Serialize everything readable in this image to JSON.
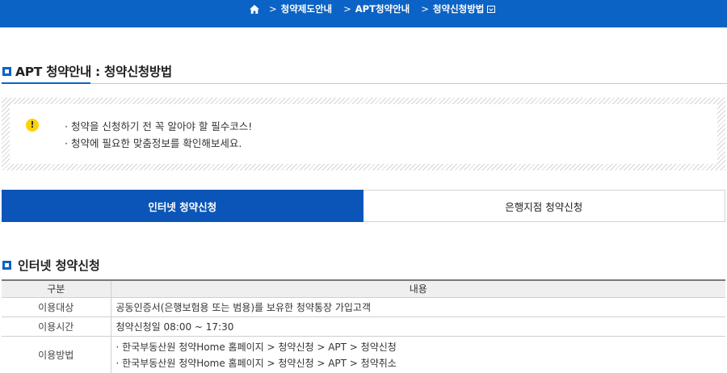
{
  "breadcrumb": {
    "home_icon": "home-icon",
    "separator": ">",
    "items": [
      "청약제도안내",
      "APT청약안내",
      "청약신청방법"
    ],
    "dropdown_icon": "chevron-down-box-icon"
  },
  "page": {
    "title": "APT 청약안내 : 청약신청방법"
  },
  "notice": {
    "icon": "exclamation-icon",
    "icon_glyph": "!",
    "lines": [
      "· 청약을 신청하기 전 꼭 알아야 할 필수코스!",
      "· 청약에 필요한 맞춤정보를 확인해보세요."
    ]
  },
  "tabs": [
    {
      "label": "인터넷 청약신청",
      "active": true
    },
    {
      "label": "은행지점 청약신청",
      "active": false
    }
  ],
  "section": {
    "title": "인터넷 청약신청"
  },
  "table": {
    "headers": [
      "구분",
      "내용"
    ],
    "rows": [
      {
        "label": "이용대상",
        "content": [
          "공동인증서(은행보험용 또는 범용)를 보유한 청약통장 가입고객"
        ]
      },
      {
        "label": "이용시간",
        "content": [
          "청약신청일 08:00 ~ 17:30"
        ]
      },
      {
        "label": "이용방법",
        "content": [
          "한국부동산원 청약Home 홈페이지 > 청약신청 > APT > 청약신청",
          "한국부동산원 청약Home 홈페이지 > 청약신청 > APT > 청약취소"
        ]
      }
    ]
  },
  "colors": {
    "brand_blue": "#0b63c5",
    "active_tab": "#0b55b8",
    "warning_yellow": "#ffd200"
  }
}
